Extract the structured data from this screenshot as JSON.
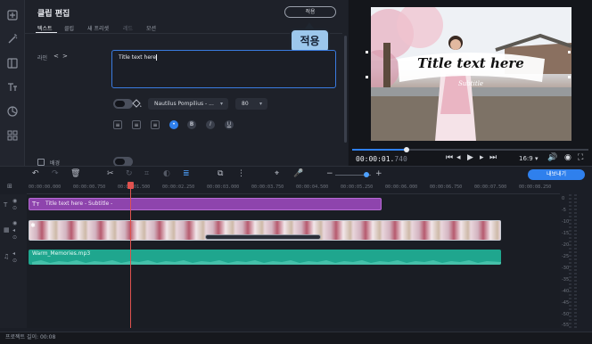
{
  "editor": {
    "title": "클립 편집",
    "apply_label": "적용",
    "tooltip": "적용",
    "tabs": [
      {
        "label": "텍스트"
      },
      {
        "label": "클립"
      },
      {
        "label": "새 프리셋"
      },
      {
        "label": "레드"
      },
      {
        "label": "모션"
      }
    ],
    "line_label": "라인",
    "line_prev": "<",
    "line_next": ">",
    "text_value": "Title text here",
    "font_name": "Nautilus Pompilius - ...",
    "font_size": "80",
    "background_label": "배경"
  },
  "preview": {
    "title_text": "Title text here",
    "subtitle_text": "Subtitle",
    "timecode_main": "00:00:01.",
    "timecode_ms": "740",
    "aspect_ratio": "16:9",
    "progress_fraction": 0.23
  },
  "export_label": "내보내기",
  "ruler": [
    "00:00:00.000",
    "00:00:00.750",
    "00:00:01.500",
    "00:00:02.250",
    "00:00:03.000",
    "00:00:03.750",
    "00:00:04.500",
    "00:00:05.250",
    "00:00:06.000",
    "00:00:06.750",
    "00:00:07.500",
    "00:00:08.250"
  ],
  "timeline": {
    "title_clip": "Title text here - Subtitle -",
    "audio_clip": "Warm_Memories.mp3"
  },
  "meter_labels": [
    "0",
    "-5",
    "-10",
    "-15",
    "-20",
    "-25",
    "-30",
    "-35",
    "-40",
    "-45",
    "-50",
    "-55"
  ],
  "status": {
    "project_length_label": "프로젝트 길이:",
    "project_length": "00:08"
  },
  "colors": {
    "accent": "#2f80ed",
    "title_clip": "#8e44ad",
    "audio_clip": "#1fa68e",
    "playhead": "#e0524f",
    "tooltip": "#9cc7ec"
  }
}
